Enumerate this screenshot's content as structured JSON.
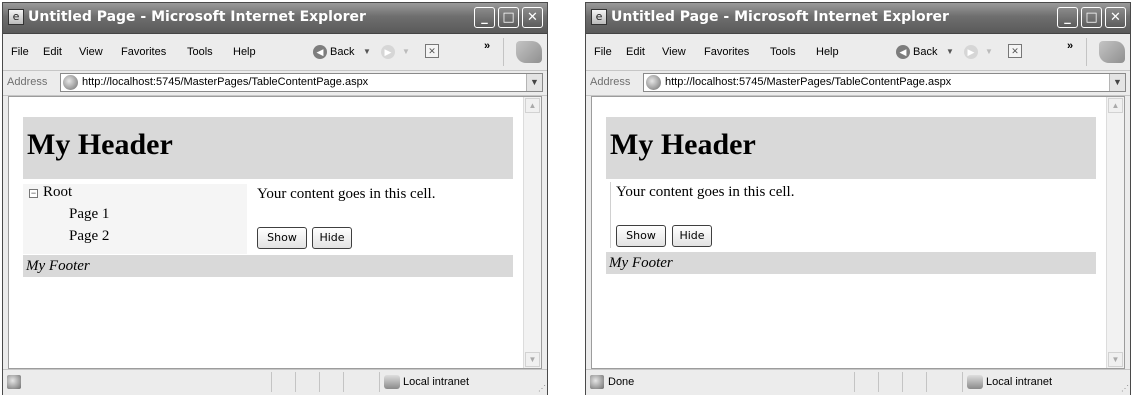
{
  "windows": [
    {
      "title": "Untitled Page - Microsoft Internet Explorer",
      "menu": [
        "File",
        "Edit",
        "View",
        "Favorites",
        "Tools",
        "Help"
      ],
      "toolbar": {
        "back_label": "Back",
        "chevron": "»"
      },
      "address": {
        "label": "Address",
        "url": "http://localhost:5745/MasterPages/TableContentPage.aspx"
      },
      "page": {
        "header": "My Header",
        "content_text": "Your content goes in this cell.",
        "show_button": "Show",
        "hide_button": "Hide",
        "footer": "My Footer",
        "tree": {
          "root": "Root",
          "items": [
            "Page 1",
            "Page 2"
          ],
          "toggle_symbol": "⊟"
        }
      },
      "status": {
        "text": "",
        "zone": "Local intranet"
      }
    },
    {
      "title": "Untitled Page - Microsoft Internet Explorer",
      "menu": [
        "File",
        "Edit",
        "View",
        "Favorites",
        "Tools",
        "Help"
      ],
      "toolbar": {
        "back_label": "Back",
        "chevron": "»"
      },
      "address": {
        "label": "Address",
        "url": "http://localhost:5745/MasterPages/TableContentPage.aspx"
      },
      "page": {
        "header": "My Header",
        "content_text": "Your content goes in this cell.",
        "show_button": "Show",
        "hide_button": "Hide",
        "footer": "My Footer"
      },
      "status": {
        "text": "Done",
        "zone": "Local intranet"
      }
    }
  ],
  "icons": {
    "window_icon": "ie-page-icon",
    "minimize": "minimize-icon",
    "maximize": "maximize-icon",
    "close": "close-icon",
    "back": "back-arrow-icon",
    "forward": "forward-arrow-icon",
    "stop": "stop-icon",
    "windows_flag": "windows-logo-icon",
    "address_page": "page-icon",
    "zone": "intranet-icon"
  },
  "colors": {
    "title_bar": "#6e6e6e",
    "chrome": "#ececec",
    "header_band": "#d9d9d9",
    "footer_band": "#d9d9d9",
    "nav_panel": "#f5f5f5"
  }
}
